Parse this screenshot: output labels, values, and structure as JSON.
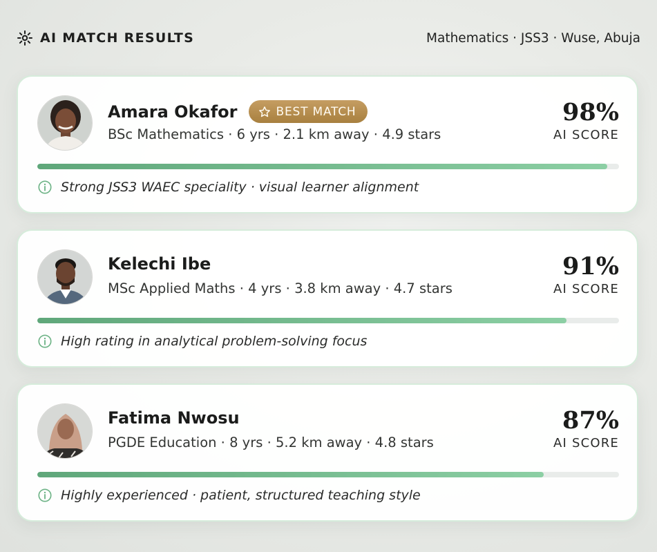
{
  "header": {
    "icon": "sparkle-icon",
    "title": "AI MATCH RESULTS",
    "context": "Mathematics · JSS3 · Wuse, Abuja"
  },
  "colors": {
    "accent_green": "#6db386",
    "badge_gold": "#b88f4f",
    "card_border": "#d6ecdb"
  },
  "results": [
    {
      "name": "Amara Okafor",
      "badge": "BEST MATCH",
      "badge_icon": "star-outline-icon",
      "meta": "BSc Mathematics · 6 yrs · 2.1 km away · 4.9 stars",
      "score": "98%",
      "score_label": "AI SCORE",
      "score_fraction": 0.98,
      "insight": "Strong JSS3 WAEC speciality · visual learner alignment",
      "insight_icon": "info-icon"
    },
    {
      "name": "Kelechi Ibe",
      "meta": "MSc Applied Maths · 4 yrs · 3.8 km away · 4.7 stars",
      "score": "91%",
      "score_label": "AI SCORE",
      "score_fraction": 0.91,
      "insight": "High rating in analytical problem-solving focus",
      "insight_icon": "info-icon"
    },
    {
      "name": "Fatima Nwosu",
      "meta": "PGDE Education · 8 yrs · 5.2 km away · 4.8 stars",
      "score": "87%",
      "score_label": "AI SCORE",
      "score_fraction": 0.87,
      "insight": "Highly experienced · patient, structured teaching style",
      "insight_icon": "info-icon"
    }
  ]
}
